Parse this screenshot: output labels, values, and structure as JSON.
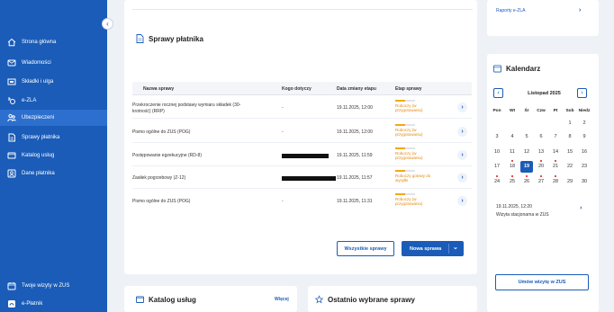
{
  "colors": {
    "primary": "#1a5cb8",
    "status_orange": "#f0a81a",
    "today": "#1a5cb8",
    "event_dot": "#d7191c"
  },
  "sidebar": {
    "collapse_icon": "chevron-left-icon",
    "items": [
      {
        "label": "Strona główna",
        "icon": "home-icon"
      },
      {
        "label": "Wiadomości",
        "icon": "mail-icon"
      },
      {
        "label": "Składki i ulga",
        "icon": "coins-icon"
      },
      {
        "label": "e-ZLA",
        "icon": "medical-icon"
      },
      {
        "label": "Ubezpieczeni",
        "icon": "people-icon"
      },
      {
        "label": "Sprawy płatnika",
        "icon": "document-icon"
      },
      {
        "label": "Katalog usług",
        "icon": "catalog-icon"
      },
      {
        "label": "Dane płatnika",
        "icon": "id-card-icon"
      }
    ],
    "bottom_items": [
      {
        "label": "Twoje wizyty w ZUS",
        "icon": "calendar-icon"
      },
      {
        "label": "e-Płatnik",
        "icon": "app-icon"
      }
    ]
  },
  "cases": {
    "title": "Sprawy płatnika",
    "columns": [
      "Nazwa sprawy",
      "Kogo dotyczy",
      "Data zmiany etapu",
      "Etap sprawy"
    ],
    "rows": [
      {
        "name_line1": "Przekroczenie rocznej podstawy wymiaru składek (30-",
        "name_line2": "krotność) (RRP)",
        "who": "-",
        "date": "19.11.2025, 12:00",
        "status_line1": "Roboczy (w",
        "status_line2": "przygotowaniu)",
        "progress": 0.5
      },
      {
        "name_line1": "Pismo ogólne do ZUS (POG)",
        "name_line2": "",
        "who": "-",
        "date": "19.11.2025, 12:00",
        "status_line1": "Roboczy (w",
        "status_line2": "przygotowaniu)",
        "progress": 0.5
      },
      {
        "name_line1": "Postępowanie egzekucyjne (RD-8)",
        "name_line2": "",
        "who": "",
        "date": "19.11.2025, 11:59",
        "status_line1": "Roboczy (w",
        "status_line2": "przygotowaniu)",
        "progress": 0.5
      },
      {
        "name_line1": "Zasiłek pogrzebowy (Z-12)",
        "name_line2": "",
        "who": "",
        "date": "19.11.2025, 11:57",
        "status_line1": "Roboczy gotowy do",
        "status_line2": "wysyłki",
        "progress": 0.5
      },
      {
        "name_line1": "Pismo ogólne do ZUS (POG)",
        "name_line2": "",
        "who": "-",
        "date": "19.11.2025, 11:31",
        "status_line1": "Roboczy (w",
        "status_line2": "przygotowaniu)",
        "progress": 0.5
      }
    ],
    "all_button": "Wszystkie sprawy",
    "new_button": "Nowa sprawa"
  },
  "catalog": {
    "title": "Katalog usług",
    "more": "Więcej"
  },
  "recent": {
    "title": "Ostatnio wybrane sprawy"
  },
  "reports": {
    "label": "Raporty e-ZLA"
  },
  "calendar": {
    "title": "Kalendarz",
    "month": "Listopad 2025",
    "weekdays": [
      "Pon",
      "Wt",
      "Śr",
      "Czw",
      "Pt",
      "Sob",
      "Niedz"
    ],
    "weeks": [
      [
        "",
        "",
        "",
        "",
        "",
        "1",
        "2"
      ],
      [
        "3",
        "4",
        "5",
        "6",
        "7",
        "8",
        "9"
      ],
      [
        "10",
        "11",
        "12",
        "13",
        "14",
        "15",
        "16"
      ],
      [
        "17",
        "18",
        "19",
        "20",
        "21",
        "22",
        "23"
      ],
      [
        "24",
        "25",
        "26",
        "27",
        "28",
        "29",
        "30"
      ]
    ],
    "today": "19",
    "event_days": [
      "18",
      "20",
      "21",
      "24",
      "25",
      "26",
      "27",
      "28"
    ],
    "visit_date": "19.11.2025, 12:20",
    "visit_title": "Wizyta stacjonarna w ZUS",
    "book_button": "Umów wizytę w ZUS"
  }
}
